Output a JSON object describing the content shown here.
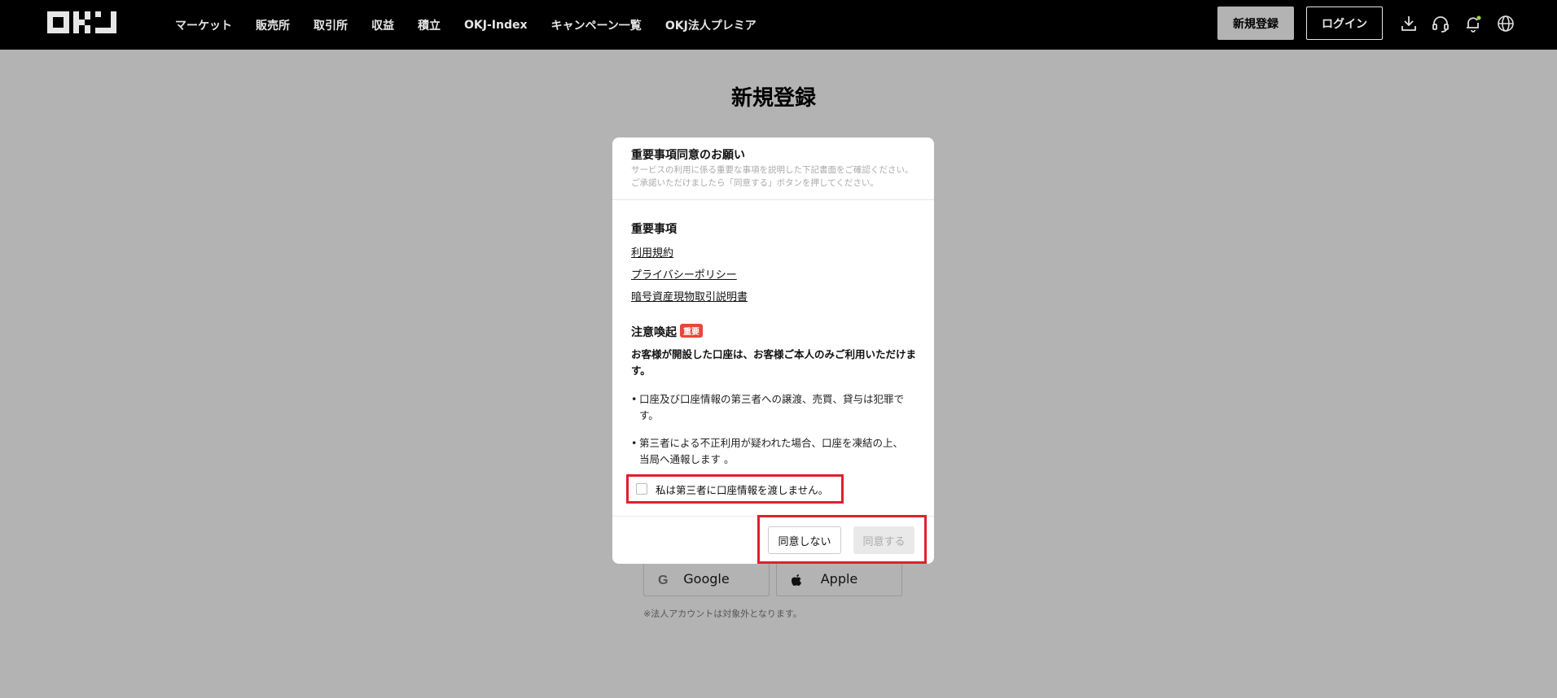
{
  "header": {
    "logo": "OKJ",
    "nav": [
      "マーケット",
      "販売所",
      "取引所",
      "収益",
      "積立",
      "OKJ-Index",
      "キャンペーン一覧",
      "OKJ法人プレミア"
    ],
    "signup_label": "新規登録",
    "login_label": "ログイン",
    "icons": [
      "download-icon",
      "headset-icon",
      "bell-icon",
      "globe-icon"
    ]
  },
  "page": {
    "title": "新規登録",
    "social": {
      "google_label": "Google",
      "apple_label": "Apple"
    },
    "note": "※法人アカウントは対象外となります。"
  },
  "modal": {
    "title": "重要事項同意のお願い",
    "subtitle": "サービスの利用に係る重要な事項を説明した下記書面をご確認ください。ご承諾いただけましたら「同意する」ボタンを押してください。",
    "important_title": "重要事項",
    "links": [
      "利用規約",
      "プライバシーポリシー",
      "暗号資産現物取引説明書"
    ],
    "caution_title": "注意喚起",
    "caution_badge": "重要",
    "caution_bold": "お客様が開設した口座は、お客様ご本人のみご利用いただけます。",
    "bullets": [
      "口座及び口座情報の第三者への譲渡、売買、貸与は犯罪です。",
      "第三者による不正利用が疑われた場合、口座を凍結の上、当局へ通報します 。"
    ],
    "checkbox_label": "私は第三者に口座情報を渡しません。",
    "checkbox_checked": false,
    "disagree_label": "同意しない",
    "agree_label": "同意する"
  },
  "colors": {
    "header_bg": "#000000",
    "overlay_bg": "#b3b3b3",
    "highlight": "#e0202e",
    "badge": "#e5483b"
  }
}
